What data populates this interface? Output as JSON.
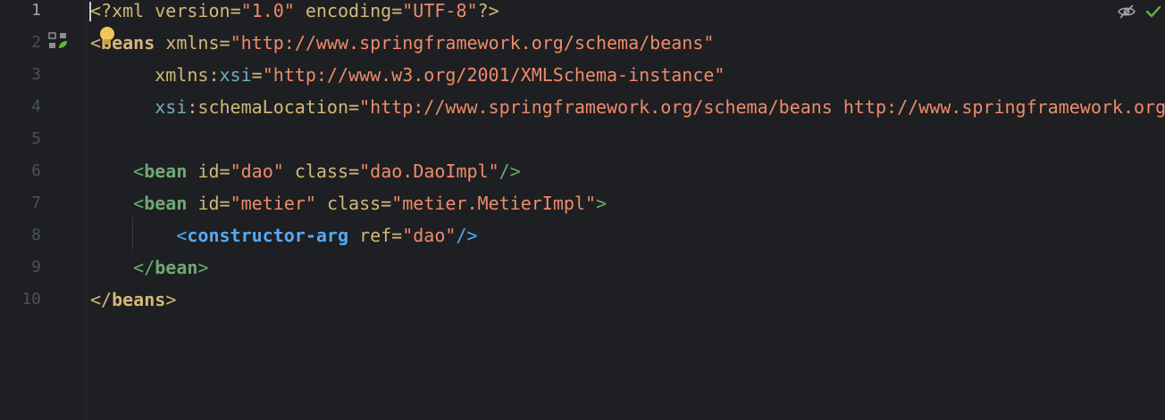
{
  "editor": {
    "current_line": 1,
    "line_numbers": [
      "1",
      "2",
      "3",
      "4",
      "5",
      "6",
      "7",
      "8",
      "9",
      "10"
    ],
    "lines": {
      "l1": {
        "open": "<?",
        "name": "xml",
        "a1": "version",
        "v1": "\"1.0\"",
        "a2": "encoding",
        "v2": "\"UTF-8\"",
        "close": "?>"
      },
      "l2": {
        "open": "<",
        "name": "beans",
        "attr": "xmlns",
        "value": "\"http://www.springframework.org/schema/beans\""
      },
      "l3": {
        "attr": "xmlns",
        "ns": "xsi",
        "value": "\"http://www.w3.org/2001/XMLSchema-instance\""
      },
      "l4": {
        "ns": "xsi",
        "attr": "schemaLocation",
        "value": "\"http://www.springframework.org/schema/beans http://www.springframework.org/schema/beans/spring-beans.xsd\""
      },
      "l6": {
        "open": "<",
        "name": "bean",
        "a1": "id",
        "v1": "\"dao\"",
        "a2": "class",
        "v2": "\"dao.DaoImpl\"",
        "close": "/>"
      },
      "l7": {
        "open": "<",
        "name": "bean",
        "a1": "id",
        "v1": "\"metier\"",
        "a2": "class",
        "v2": "\"metier.MetierImpl\"",
        "close": ">"
      },
      "l8": {
        "open": "<",
        "name": "constructor-arg",
        "a1": "ref",
        "v1": "\"dao\"",
        "close": "/>"
      },
      "l9": {
        "open": "</",
        "name": "bean",
        "close": ">"
      },
      "l10": {
        "open": "</",
        "name": "beans",
        "close": ">"
      }
    }
  },
  "icons": {
    "bulb": "lightbulb-icon",
    "gutter": "spring-bean-icon",
    "reader_mode": "eye-crossed-icon",
    "inspection": "checkmark-icon"
  },
  "colors": {
    "background": "#1e1f22",
    "tag": "#d5b778",
    "string": "#ee8b6a",
    "namespace": "#6fafbd",
    "bean_tag": "#6aab73",
    "constructor_tag": "#56a8f5",
    "checkmark": "#5fb832"
  }
}
